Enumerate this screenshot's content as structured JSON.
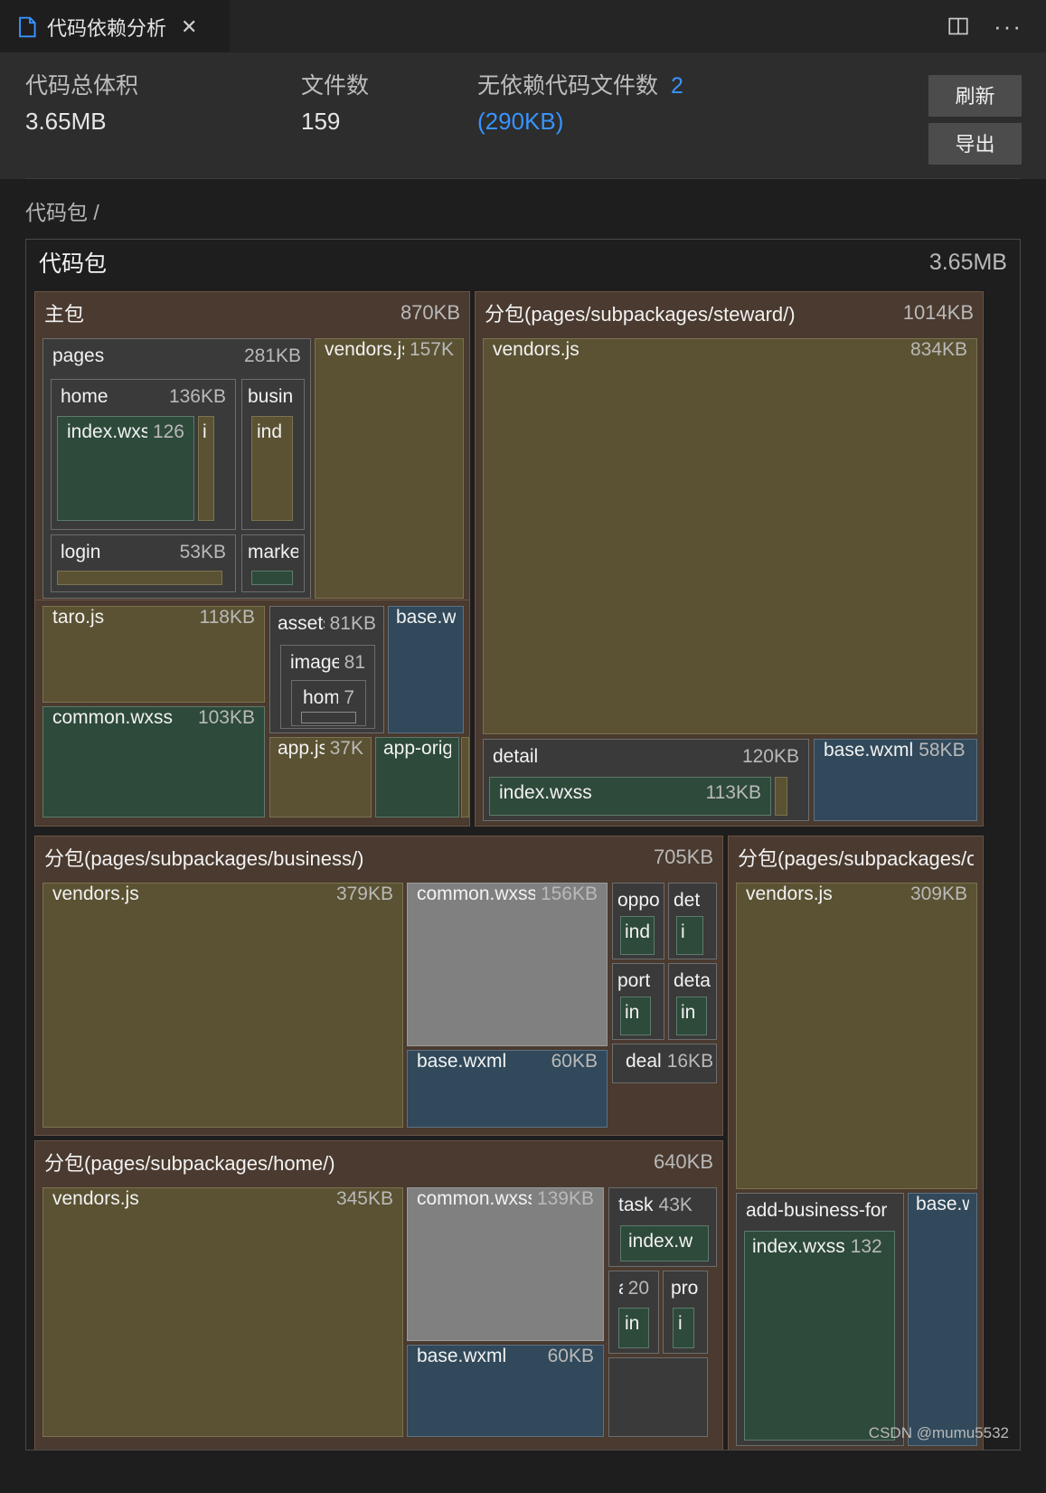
{
  "tab": {
    "title": "代码依赖分析",
    "file_icon": "file-icon",
    "close_icon": "close-icon",
    "split_editor_icon": "split-editor-icon",
    "more_actions_icon": "more-actions-icon"
  },
  "summary": {
    "total_size_label": "代码总体积",
    "total_size_value": "3.65MB",
    "file_count_label": "文件数",
    "file_count_value": "159",
    "no_dep_label": "无依赖代码文件数",
    "no_dep_count": "2",
    "no_dep_size": "(290KB)",
    "refresh_button": "刷新",
    "export_button": "导出",
    "accent_color": "#3794ff"
  },
  "breadcrumb": "代码包 /",
  "treemap": {
    "root": {
      "name": "代码包",
      "size": "3.65MB"
    },
    "main_package": {
      "name": "主包",
      "size": "870KB"
    },
    "pages": {
      "name": "pages",
      "size": "281KB"
    },
    "home": {
      "name": "home",
      "size": "136KB"
    },
    "home_index_wxss": {
      "name": "index.wxss",
      "size": "126"
    },
    "home_index_js": {
      "name": "i"
    },
    "business_dir": {
      "name": "busin"
    },
    "business_index": {
      "name": "ind"
    },
    "market_dir": {
      "name": "marke"
    },
    "login": {
      "name": "login",
      "size": "53KB"
    },
    "vendors_main": {
      "name": "vendors.js",
      "size": "157K"
    },
    "taro": {
      "name": "taro.js",
      "size": "118KB"
    },
    "common_wxss_main": {
      "name": "common.wxss",
      "size": "103KB"
    },
    "assets": {
      "name": "assets",
      "size": "81KB"
    },
    "images": {
      "name": "images",
      "size": "81"
    },
    "images_home": {
      "name": "home",
      "size": "7"
    },
    "base_wxss_main": {
      "name": "base.wx"
    },
    "app_js": {
      "name": "app.js",
      "size": "37K"
    },
    "app_orig": {
      "name": "app-orig"
    },
    "steward": {
      "name": "分包(pages/subpackages/steward/)",
      "size": "1014KB"
    },
    "steward_vendors": {
      "name": "vendors.js",
      "size": "834KB"
    },
    "steward_detail": {
      "name": "detail",
      "size": "120KB"
    },
    "steward_detail_index": {
      "name": "index.wxss",
      "size": "113KB"
    },
    "steward_base_wxml": {
      "name": "base.wxml",
      "size": "58KB"
    },
    "business": {
      "name": "分包(pages/subpackages/business/)",
      "size": "705KB"
    },
    "business_vendors": {
      "name": "vendors.js",
      "size": "379KB"
    },
    "business_common": {
      "name": "common.wxss",
      "size": "156KB"
    },
    "business_oppo": {
      "name": "oppo"
    },
    "business_oppo_index": {
      "name": "ind"
    },
    "business_det": {
      "name": "det"
    },
    "business_det_index": {
      "name": "i"
    },
    "business_port": {
      "name": "port"
    },
    "business_port_index": {
      "name": "in"
    },
    "business_deta": {
      "name": "deta"
    },
    "business_deta_index": {
      "name": "in"
    },
    "business_deal": {
      "name": "deal",
      "size": "16KB"
    },
    "business_base_wxml": {
      "name": "base.wxml",
      "size": "60KB"
    },
    "other_pkg": {
      "name": "分包(pages/subpackages/o"
    },
    "other_vendors": {
      "name": "vendors.js",
      "size": "309KB"
    },
    "other_add_business": {
      "name": "add-business-for"
    },
    "other_add_business_index": {
      "name": "index.wxss",
      "size": "132"
    },
    "other_base_w": {
      "name": "base.w"
    },
    "home_pkg": {
      "name": "分包(pages/subpackages/home/)",
      "size": "640KB"
    },
    "home_vendors": {
      "name": "vendors.js",
      "size": "345KB"
    },
    "home_common": {
      "name": "common.wxss",
      "size": "139KB"
    },
    "home_base_wxml": {
      "name": "base.wxml",
      "size": "60KB"
    },
    "home_task": {
      "name": "task",
      "size": "43K"
    },
    "home_task_index": {
      "name": "index.w"
    },
    "home_all": {
      "name": "all",
      "size": "20"
    },
    "home_all_index": {
      "name": "in"
    },
    "home_pro": {
      "name": "pro"
    },
    "home_pro_index": {
      "name": "i"
    }
  },
  "watermark": "CSDN @mumu5532"
}
